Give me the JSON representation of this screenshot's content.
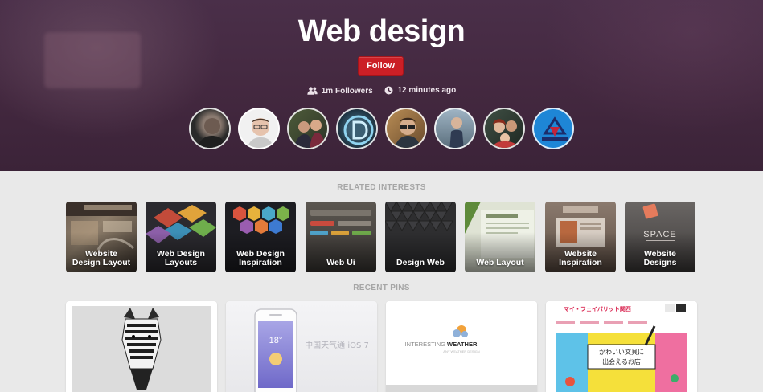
{
  "board": {
    "title": "Web design",
    "follow_label": "Follow",
    "followers": "1m Followers",
    "updated": "12 minutes ago"
  },
  "followers_avatars": [
    {
      "name": "follower-1"
    },
    {
      "name": "follower-2"
    },
    {
      "name": "follower-3"
    },
    {
      "name": "follower-4"
    },
    {
      "name": "follower-5"
    },
    {
      "name": "follower-6"
    },
    {
      "name": "follower-7"
    },
    {
      "name": "follower-8"
    }
  ],
  "sections": {
    "related_interests": "RELATED INTERESTS",
    "recent_pins": "RECENT PINS"
  },
  "interests": [
    {
      "line1": "Website",
      "line2": "Design Layout"
    },
    {
      "line1": "Web Design",
      "line2": "Layouts"
    },
    {
      "line1": "Web Design",
      "line2": "Inspiration"
    },
    {
      "line1": "Web Ui",
      "line2": ""
    },
    {
      "line1": "Design Web",
      "line2": ""
    },
    {
      "line1": "Web Layout",
      "line2": ""
    },
    {
      "line1": "Website",
      "line2": "Inspiration"
    },
    {
      "line1": "Website",
      "line2": "Designs"
    }
  ],
  "pins": {
    "weather_app_caption": "中国天气通 iOS 7",
    "weather_app_temp": "18°",
    "interesting_weather_title_1": "INTERESTING",
    "interesting_weather_title_2": "WEATHER",
    "interesting_weather_sub": "ANY WEATHER DESIGN",
    "japan_site_title": "マイ・フェイバリット関西",
    "japan_site_tagline_1": "かわいい文具に",
    "japan_site_tagline_2": "出会えるお店",
    "cover_space": "SPACE"
  },
  "colors": {
    "hero": "#43283f",
    "follow_button": "#cb1f26",
    "page_bg": "#e9e9e9"
  }
}
